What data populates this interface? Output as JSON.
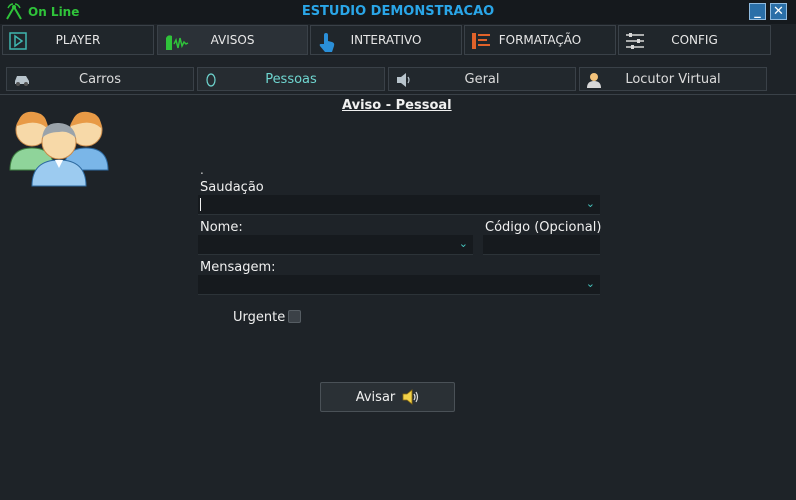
{
  "titlebar": {
    "status": "On Line",
    "title": "ESTUDIO DEMONSTRACAO",
    "minimize_glyph": "_",
    "close_glyph": "✕"
  },
  "main_tabs": [
    {
      "label": "PLAYER",
      "icon": "player-icon"
    },
    {
      "label": "AVISOS",
      "icon": "voice-wave-icon",
      "active": true
    },
    {
      "label": "INTERATIVO",
      "icon": "touch-hand-icon"
    },
    {
      "label": "FORMATAÇÃO",
      "icon": "format-lines-icon"
    },
    {
      "label": "CONFIG",
      "icon": "sliders-icon"
    }
  ],
  "sub_tabs": [
    {
      "label": "Carros",
      "icon": "car-icon"
    },
    {
      "label": "Pessoas",
      "icon": "person-outline-icon",
      "active": true
    },
    {
      "label": "Geral",
      "icon": "speaker-icon"
    },
    {
      "label": "Locutor Virtual",
      "icon": "announcer-icon"
    }
  ],
  "form": {
    "section_title": "Aviso - Pessoal",
    "dot": ".",
    "saudacao_label": "Saudação",
    "saudacao_value": "",
    "nome_label": "Nome:",
    "nome_value": "",
    "codigo_label": "Código (Opcional)",
    "codigo_value": "",
    "mensagem_label": "Mensagem:",
    "mensagem_value": "",
    "urgente_label": "Urgente",
    "urgente_checked": false,
    "submit_label": "Avisar"
  },
  "colors": {
    "background": "#1e2328",
    "title": "#2aa6e8",
    "online": "#2fc33a",
    "active_subtab": "#6fd6d0"
  }
}
